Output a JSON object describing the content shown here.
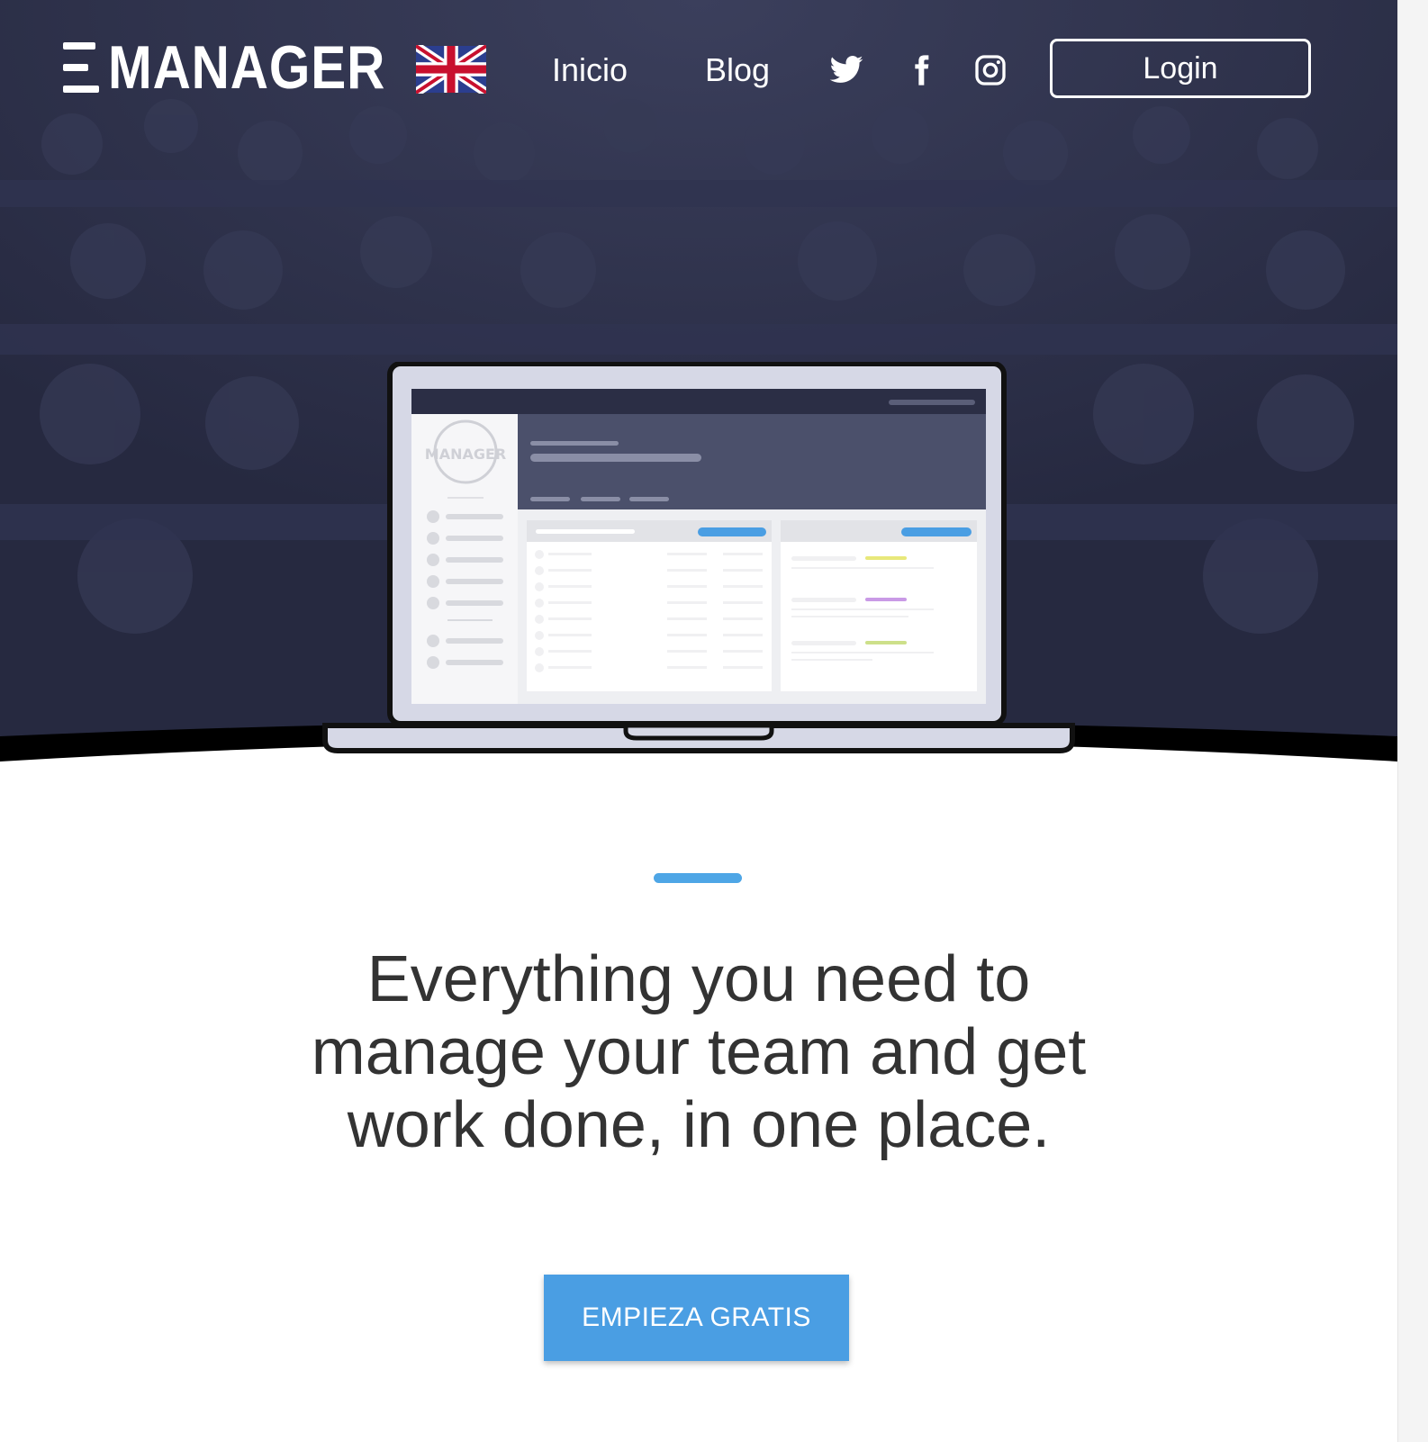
{
  "brand": {
    "name": "MANAGER",
    "language_flag": "uk-flag-icon"
  },
  "nav": {
    "links": [
      {
        "label": "Inicio"
      },
      {
        "label": "Blog"
      }
    ],
    "social": [
      {
        "icon": "twitter-icon"
      },
      {
        "icon": "facebook-icon"
      },
      {
        "icon": "instagram-icon"
      }
    ],
    "login_label": "Login"
  },
  "hero": {
    "accent_color": "#4ea6e6",
    "background_color": "#2b2e45"
  },
  "main": {
    "headline": "Everything you need to manage your team and get work done, in one place.",
    "cta_label": "EMPIEZA GRATIS",
    "cta_color": "#4a9ee3"
  }
}
